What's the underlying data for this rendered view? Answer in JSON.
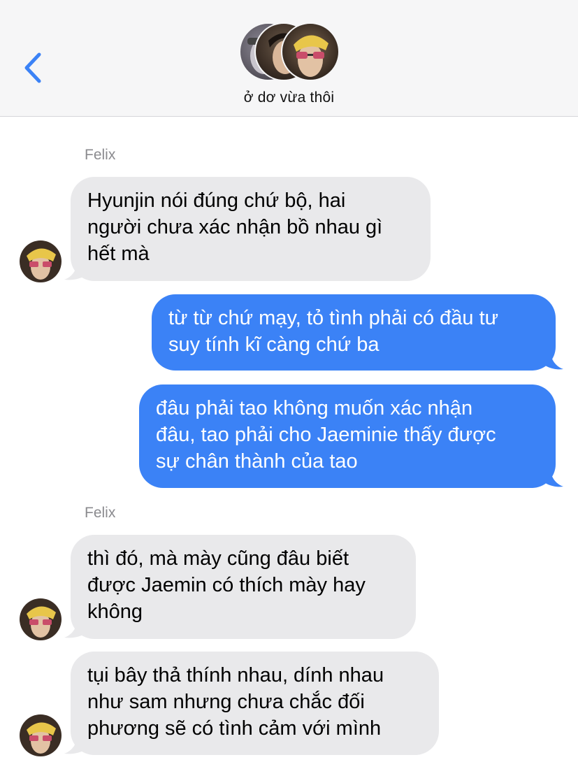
{
  "header": {
    "title": "ở dơ vừa thôi",
    "back_icon": "chevron-left-icon",
    "accent": "#3b82f6"
  },
  "messages": [
    {
      "sender": "Felix",
      "direction": "incoming",
      "text": "Hyunjin nói đúng chứ bộ, hai\nngười chưa xác nhận bồ nhau gì\nhết mà"
    },
    {
      "direction": "outgoing",
      "text": "từ từ chứ mạy, tỏ tình phải có đầu tư\nsuy tính kĩ càng chứ ba"
    },
    {
      "direction": "outgoing",
      "text": "đâu phải tao không muốn xác nhận\nđâu, tao phải cho Jaeminie thấy được\nsự chân thành của tao"
    },
    {
      "sender": "Felix",
      "direction": "incoming",
      "text": "thì đó, mà mày cũng đâu biết\nđược Jaemin có thích mày hay\nkhông"
    },
    {
      "direction": "incoming",
      "text": "tụi bây thả thính nhau, dính nhau\nnhư sam nhưng chưa chắc đối\nphương sẽ có tình cảm với mình"
    }
  ],
  "colors": {
    "incoming_bubble": "#e9e9eb",
    "outgoing_bubble": "#3b82f6",
    "header_bg": "#f6f6f7"
  }
}
